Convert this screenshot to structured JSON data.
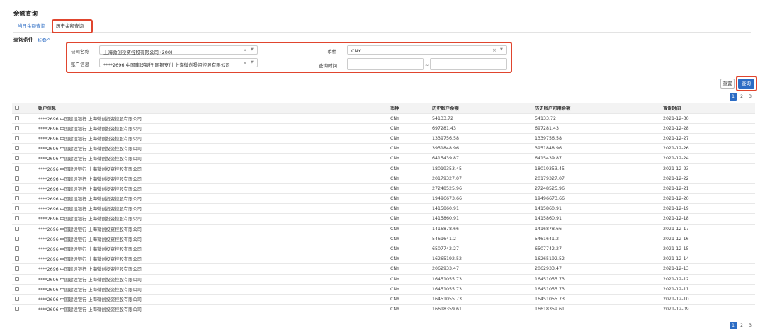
{
  "page": {
    "title": "余额查询"
  },
  "tabs": [
    {
      "label": "当日余额查询"
    },
    {
      "label": "历史余额查询"
    }
  ],
  "conditions": {
    "label": "查询条件",
    "collapse_label": "折叠^",
    "company": {
      "label": "公司名称",
      "value": "上海微创投资控股有限公司 (200)"
    },
    "account": {
      "label": "账户信息",
      "value": "****2696 中国建设银行 网银支付 上海微创投资控股有限公司"
    },
    "currency": {
      "label": "币种",
      "value": "CNY"
    },
    "date": {
      "label": "查询时间",
      "start": "",
      "end": "",
      "separator": "~"
    }
  },
  "buttons": {
    "reset": "重置",
    "search": "查询"
  },
  "pagination": {
    "pages": [
      "1",
      "2",
      "3"
    ],
    "current": "1"
  },
  "table": {
    "headers": [
      "账户信息",
      "币种",
      "历史账户余额",
      "历史账户可用余额",
      "查询时间"
    ],
    "rows": [
      [
        "****2696 中国建设银行 上海微创投资控股有限公司",
        "CNY",
        "54133.72",
        "54133.72",
        "2021-12-30"
      ],
      [
        "****2696 中国建设银行 上海微创投资控股有限公司",
        "CNY",
        "697281.43",
        "697281.43",
        "2021-12-28"
      ],
      [
        "****2696 中国建设银行 上海微创投资控股有限公司",
        "CNY",
        "1339756.58",
        "1339756.58",
        "2021-12-27"
      ],
      [
        "****2696 中国建设银行 上海微创投资控股有限公司",
        "CNY",
        "3951848.96",
        "3951848.96",
        "2021-12-26"
      ],
      [
        "****2696 中国建设银行 上海微创投资控股有限公司",
        "CNY",
        "6415439.87",
        "6415439.87",
        "2021-12-24"
      ],
      [
        "****2696 中国建设银行 上海微创投资控股有限公司",
        "CNY",
        "18019353.45",
        "18019353.45",
        "2021-12-23"
      ],
      [
        "****2696 中国建设银行 上海微创投资控股有限公司",
        "CNY",
        "20179327.07",
        "20179327.07",
        "2021-12-22"
      ],
      [
        "****2696 中国建设银行 上海微创投资控股有限公司",
        "CNY",
        "27248525.96",
        "27248525.96",
        "2021-12-21"
      ],
      [
        "****2696 中国建设银行 上海微创投资控股有限公司",
        "CNY",
        "19496673.66",
        "19496673.66",
        "2021-12-20"
      ],
      [
        "****2696 中国建设银行 上海微创投资控股有限公司",
        "CNY",
        "1415860.91",
        "1415860.91",
        "2021-12-19"
      ],
      [
        "****2696 中国建设银行 上海微创投资控股有限公司",
        "CNY",
        "1415860.91",
        "1415860.91",
        "2021-12-18"
      ],
      [
        "****2696 中国建设银行 上海微创投资控股有限公司",
        "CNY",
        "1416878.66",
        "1416878.66",
        "2021-12-17"
      ],
      [
        "****2696 中国建设银行 上海微创投资控股有限公司",
        "CNY",
        "5461641.2",
        "5461641.2",
        "2021-12-16"
      ],
      [
        "****2696 中国建设银行 上海微创投资控股有限公司",
        "CNY",
        "6507742.27",
        "6507742.27",
        "2021-12-15"
      ],
      [
        "****2696 中国建设银行 上海微创投资控股有限公司",
        "CNY",
        "16265192.52",
        "16265192.52",
        "2021-12-14"
      ],
      [
        "****2696 中国建设银行 上海微创投资控股有限公司",
        "CNY",
        "2062933.47",
        "2062933.47",
        "2021-12-13"
      ],
      [
        "****2696 中国建设银行 上海微创投资控股有限公司",
        "CNY",
        "16451055.73",
        "16451055.73",
        "2021-12-12"
      ],
      [
        "****2696 中国建设银行 上海微创投资控股有限公司",
        "CNY",
        "16451055.73",
        "16451055.73",
        "2021-12-11"
      ],
      [
        "****2696 中国建设银行 上海微创投资控股有限公司",
        "CNY",
        "16451055.73",
        "16451055.73",
        "2021-12-10"
      ],
      [
        "****2696 中国建设银行 上海微创投资控股有限公司",
        "CNY",
        "16618359.61",
        "16618359.61",
        "2021-12-09"
      ]
    ]
  },
  "colors": {
    "accent": "#2c6cc4",
    "highlight": "#e0452e",
    "frame": "#4a78d0"
  }
}
